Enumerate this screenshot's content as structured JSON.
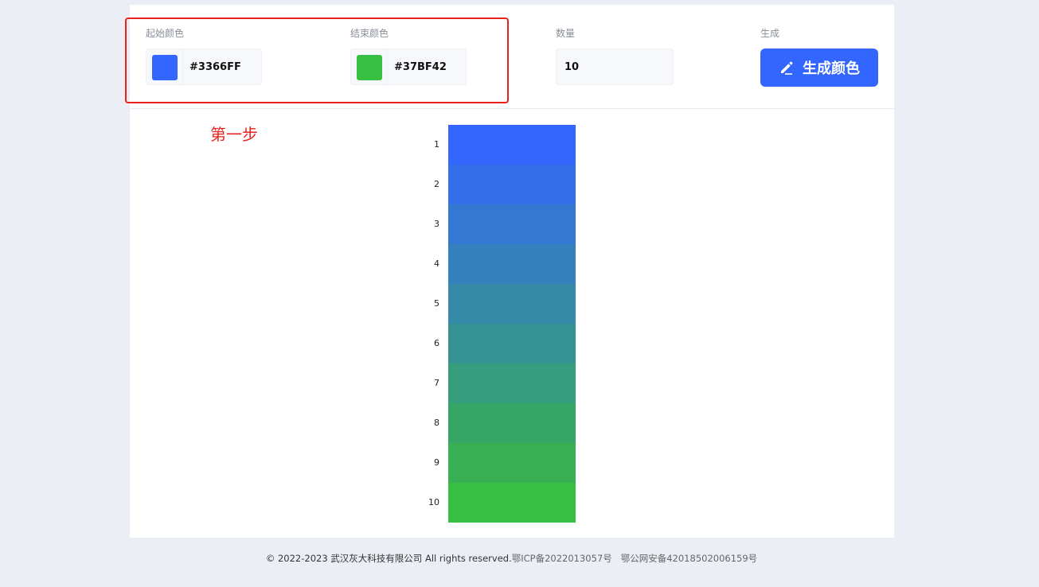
{
  "controls": {
    "start_color": {
      "label": "起始颜色",
      "value": "#3366FF",
      "swatch": "#3366ff"
    },
    "end_color": {
      "label": "结束颜色",
      "value": "#37BF42",
      "swatch": "#37bf42"
    },
    "quantity": {
      "label": "数量",
      "value": "10"
    },
    "generate": {
      "label": "生成",
      "button_label": "生成颜色",
      "icon": "pencil-icon",
      "color": "#3366ff"
    }
  },
  "annotation": {
    "step_label": "第一步",
    "color": "#e8211c"
  },
  "gradient": {
    "items": [
      {
        "number": "1",
        "color": "#3366ff"
      },
      {
        "number": "2",
        "color": "#336fe9"
      },
      {
        "number": "3",
        "color": "#3478d4"
      },
      {
        "number": "4",
        "color": "#3481be"
      },
      {
        "number": "5",
        "color": "#358aa8"
      },
      {
        "number": "6",
        "color": "#359493"
      },
      {
        "number": "7",
        "color": "#369d7d"
      },
      {
        "number": "8",
        "color": "#36a667"
      },
      {
        "number": "9",
        "color": "#37af52"
      },
      {
        "number": "10",
        "color": "#37bf42"
      }
    ]
  },
  "footer": {
    "copyright": "© 2022-2023 武汉灰大科技有限公司 All rights reserved.",
    "icp": "鄂ICP备2022013057号",
    "police": "鄂公网安备42018502006159号"
  }
}
